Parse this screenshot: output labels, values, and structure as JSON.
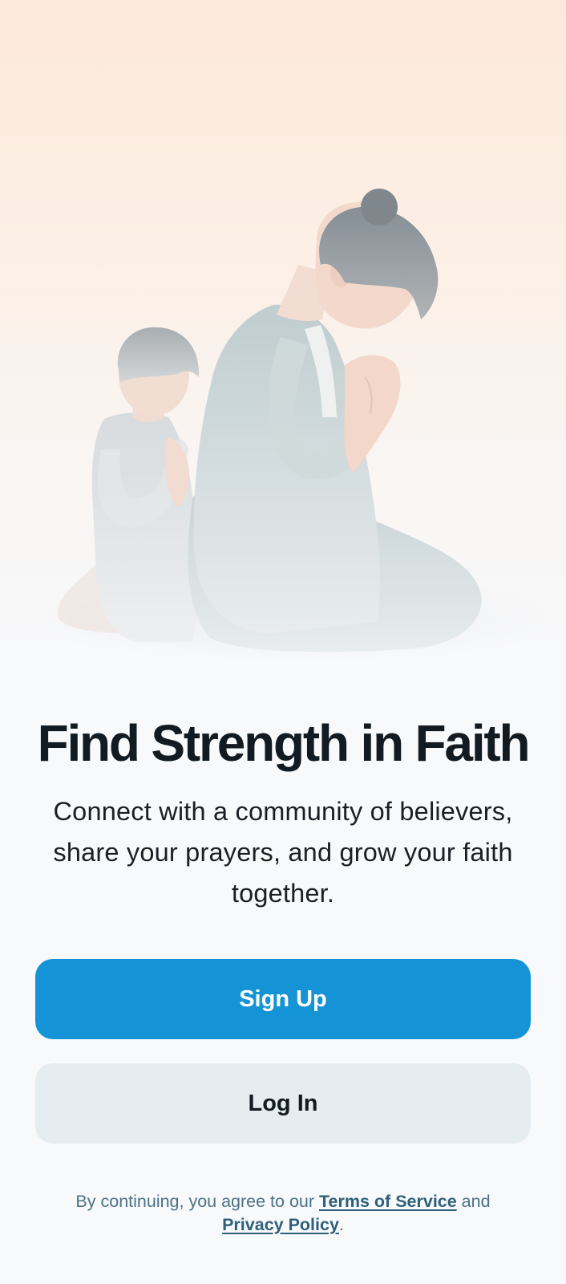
{
  "hero": {
    "illustration_icon": "praying-adult-and-child-illustration"
  },
  "main": {
    "headline": "Find Strength in Faith",
    "subtitle": "Connect with a community of believers, share your prayers, and grow your faith together."
  },
  "actions": {
    "signup_label": "Sign Up",
    "login_label": "Log In"
  },
  "legal": {
    "prefix": "By continuing, you agree to our ",
    "terms_label": "Terms of Service",
    "middle": " and",
    "privacy_label": "Privacy Policy",
    "suffix": "."
  },
  "colors": {
    "primary": "#1494d6",
    "secondary_button": "#e6edf1",
    "heading": "#111b21",
    "link": "#2f6079"
  }
}
